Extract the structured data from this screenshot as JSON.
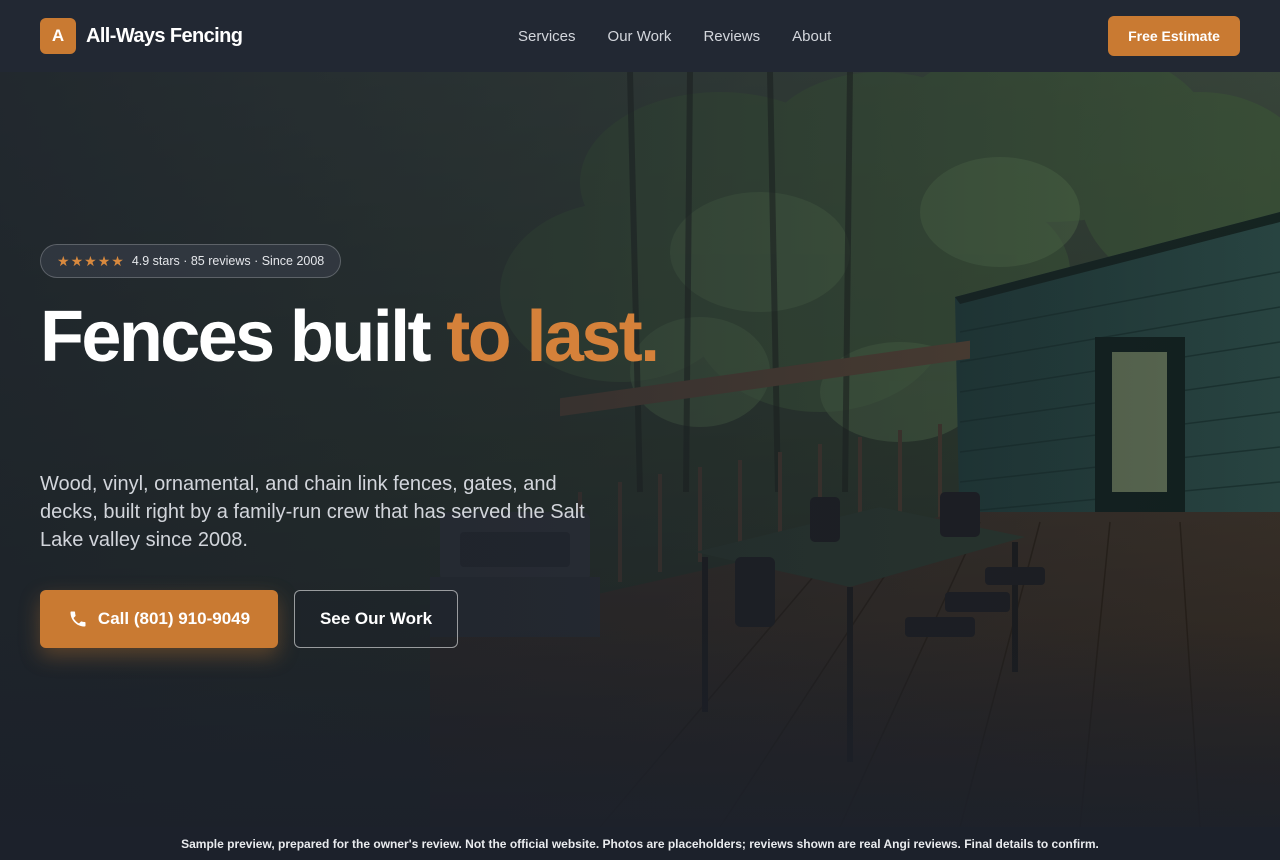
{
  "brand": {
    "mark": "A",
    "name": "All-Ways Fencing"
  },
  "nav": [
    {
      "label": "Services"
    },
    {
      "label": "Our Work"
    },
    {
      "label": "Reviews"
    },
    {
      "label": "About"
    }
  ],
  "header": {
    "cta_label": "Free Estimate"
  },
  "hero": {
    "rating": {
      "stars": 5,
      "text": "4.9 stars · 85 reviews · Since 2008"
    },
    "headline_main": "Fences built ",
    "headline_accent": "to last.",
    "subcopy": "Wood, vinyl, ornamental, and chain link fences, gates, and decks, built right by a family-run crew that has served the Salt Lake valley since 2008.",
    "call_button_label": "Call (801) 910-9049",
    "work_button_label": "See Our Work"
  },
  "footer": {
    "disclaimer": "Sample preview, prepared for the owner's review. Not the official website. Photos are placeholders; reviews shown are real Angi reviews. Final details to confirm."
  },
  "colors": {
    "accent": "#c97a32",
    "header_bg": "#222833",
    "page_bg": "#1c212b"
  },
  "icons": {
    "phone": "phone-icon",
    "star": "star-icon"
  }
}
